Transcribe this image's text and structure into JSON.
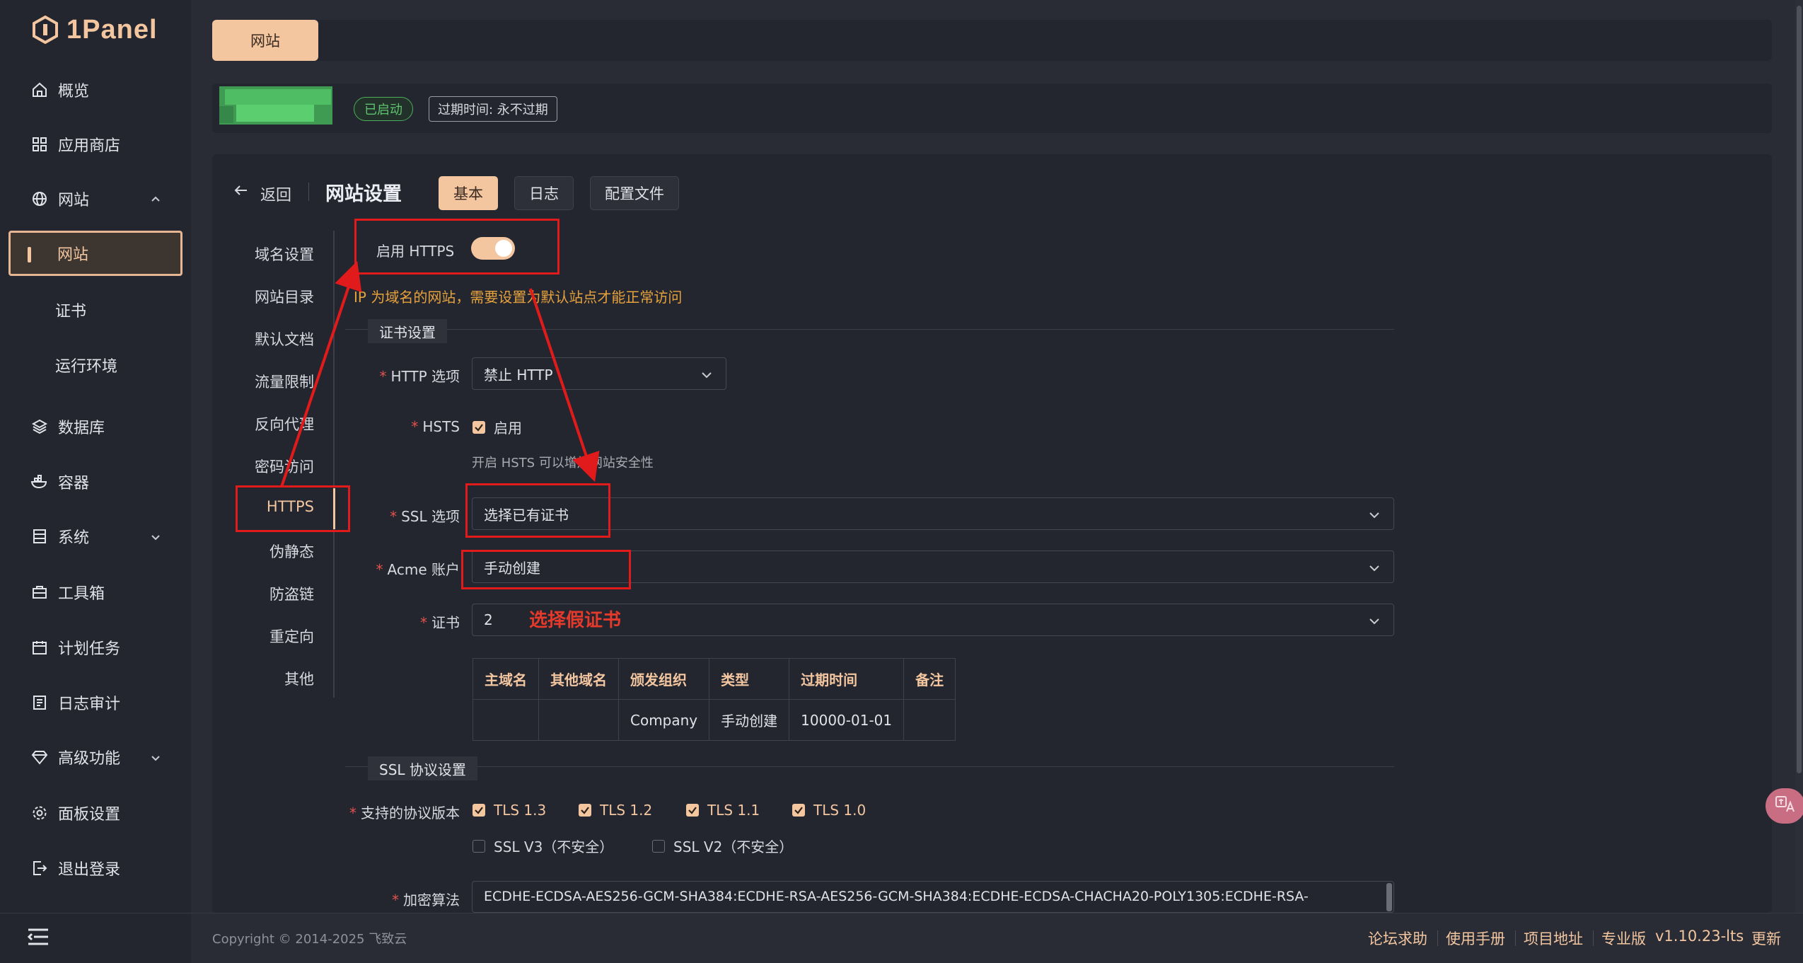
{
  "brand": {
    "name": "1Panel"
  },
  "sidebar": {
    "items": [
      {
        "label": "概览",
        "icon": "home-icon"
      },
      {
        "label": "应用商店",
        "icon": "grid-icon"
      },
      {
        "label": "网站",
        "icon": "globe-icon",
        "expanded": true
      },
      {
        "label": "网站",
        "sub": true,
        "active": true
      },
      {
        "label": "证书",
        "sub": true
      },
      {
        "label": "运行环境",
        "sub": true
      },
      {
        "label": "数据库",
        "icon": "layers-icon"
      },
      {
        "label": "容器",
        "icon": "docker-icon"
      },
      {
        "label": "系统",
        "icon": "server-icon",
        "expandable": true
      },
      {
        "label": "工具箱",
        "icon": "toolbox-icon"
      },
      {
        "label": "计划任务",
        "icon": "calendar-icon"
      },
      {
        "label": "日志审计",
        "icon": "log-icon"
      },
      {
        "label": "高级功能",
        "icon": "diamond-icon",
        "expandable": true
      },
      {
        "label": "面板设置",
        "icon": "gear-icon"
      },
      {
        "label": "退出登录",
        "icon": "logout-icon"
      }
    ]
  },
  "tabbar": {
    "active_tab": "网站"
  },
  "infobar": {
    "status": "已启动",
    "expire": "过期时间: 永不过期"
  },
  "header": {
    "back": "返回",
    "title": "网站设置",
    "tabs": [
      {
        "label": "基本",
        "active": true
      },
      {
        "label": "日志"
      },
      {
        "label": "配置文件"
      }
    ]
  },
  "settings_nav": [
    "域名设置",
    "网站目录",
    "默认文档",
    "流量限制",
    "反向代理",
    "密码访问",
    "HTTPS",
    "伪静态",
    "防盗链",
    "重定向",
    "其他"
  ],
  "settings_nav_active": "HTTPS",
  "https": {
    "enable_label": "启用 HTTPS",
    "enabled": true,
    "warning": "IP 为域名的网站，需要设置为默认站点才能正常访问",
    "cert_section": "证书设置",
    "http_option_label": "HTTP 选项",
    "http_option_value": "禁止 HTTP",
    "hsts_label": "HSTS",
    "hsts_checkbox": "启用",
    "hsts_checked": true,
    "hsts_hint": "开启 HSTS 可以增加网站安全性",
    "ssl_option_label": "SSL 选项",
    "ssl_option_value": "选择已有证书",
    "acme_label": "Acme 账户",
    "acme_value": "手动创建",
    "cert_label": "证书",
    "cert_value": "2",
    "cert_table": {
      "headers": [
        "主域名",
        "其他域名",
        "颁发组织",
        "类型",
        "过期时间",
        "备注"
      ],
      "rows": [
        [
          "",
          "",
          "Company",
          "手动创建",
          "10000-01-01",
          ""
        ]
      ]
    },
    "ssl_section": "SSL 协议设置",
    "protocols_label": "支持的协议版本",
    "protocols": [
      {
        "label": "TLS 1.3",
        "checked": true
      },
      {
        "label": "TLS 1.2",
        "checked": true
      },
      {
        "label": "TLS 1.1",
        "checked": true
      },
      {
        "label": "TLS 1.0",
        "checked": true
      },
      {
        "label": "SSL V3（不安全）",
        "checked": false
      },
      {
        "label": "SSL V2（不安全）",
        "checked": false
      }
    ],
    "cipher_label": "加密算法",
    "cipher_value": "ECDHE-ECDSA-AES256-GCM-SHA384:ECDHE-RSA-AES256-GCM-SHA384:ECDHE-ECDSA-CHACHA20-POLY1305:ECDHE-RSA-"
  },
  "annotation": {
    "text": "选择假证书",
    "color": "#e11b1b"
  },
  "footer": {
    "copyright": "Copyright © 2014-2025 飞致云",
    "links": [
      "论坛求助",
      "使用手册",
      "项目地址",
      "专业版"
    ],
    "version": "v1.10.23-lts",
    "update": "更新"
  },
  "colors": {
    "accent": "#f3c6a0",
    "background": "#292b35",
    "card": "#23252f",
    "success": "#4cae5c",
    "danger": "#e2524d",
    "warning": "#e6a23c"
  }
}
